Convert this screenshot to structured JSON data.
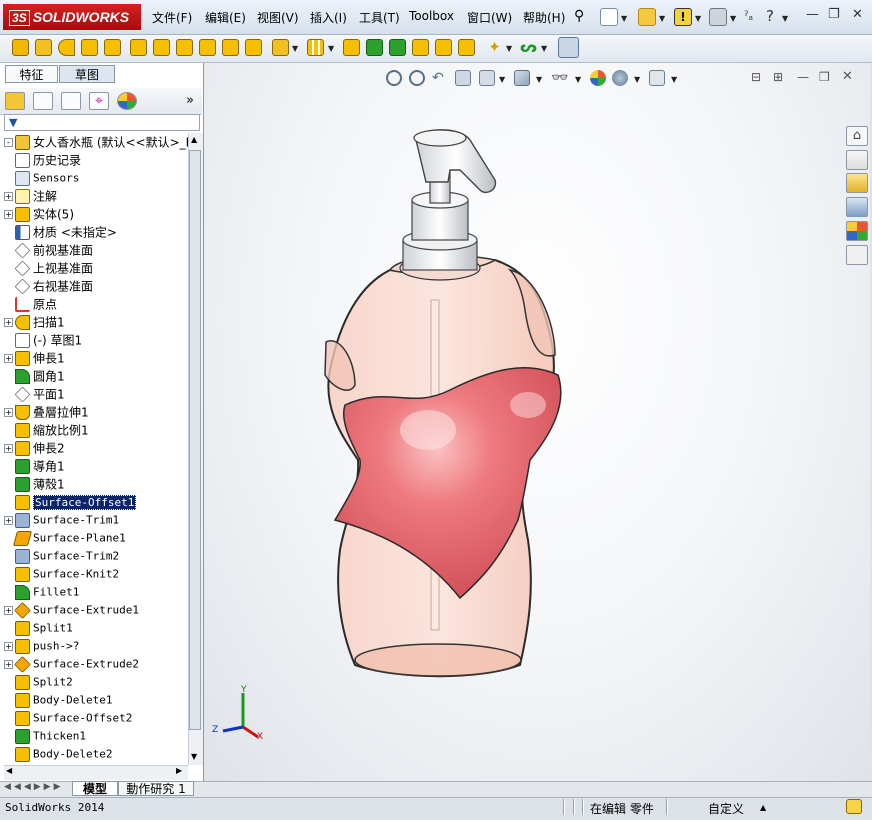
{
  "app": {
    "brand": "SOLIDWORKS",
    "ds_mark": "3S"
  },
  "menu": [
    {
      "label": "文件(F)"
    },
    {
      "label": "编辑(E)"
    },
    {
      "label": "视图(V)"
    },
    {
      "label": "插入(I)"
    },
    {
      "label": "工具(T)"
    },
    {
      "label": "Toolbox"
    },
    {
      "label": "窗口(W)"
    },
    {
      "label": "帮助(H)"
    }
  ],
  "panel_tabs": [
    {
      "label": "特征"
    },
    {
      "label": "草图"
    }
  ],
  "feature_tree": [
    {
      "label": "女人香水瓶  (默认<<默认>_Ph",
      "expand": "-",
      "icon": "part-icon"
    },
    {
      "label": "历史记录",
      "expand": "",
      "icon": "history-icon"
    },
    {
      "label": "Sensors",
      "expand": "",
      "icon": "sensor-icon",
      "mono": true
    },
    {
      "label": "注解",
      "expand": "+",
      "icon": "annotation-icon"
    },
    {
      "label": "实体(5)",
      "expand": "+",
      "icon": "solid-body-icon"
    },
    {
      "label": "材质 <未指定>",
      "expand": "",
      "icon": "material-icon"
    },
    {
      "label": "前视基准面",
      "expand": "",
      "icon": "plane-icon"
    },
    {
      "label": "上视基准面",
      "expand": "",
      "icon": "plane-icon"
    },
    {
      "label": "右视基准面",
      "expand": "",
      "icon": "plane-icon"
    },
    {
      "label": "原点",
      "expand": "",
      "icon": "origin-icon"
    },
    {
      "label": "扫描1",
      "expand": "+",
      "icon": "sweep-icon"
    },
    {
      "label": "(-) 草图1",
      "expand": "",
      "icon": "sketch-icon"
    },
    {
      "label": "伸長1",
      "expand": "+",
      "icon": "extrude-icon"
    },
    {
      "label": "圆角1",
      "expand": "",
      "icon": "fillet-icon"
    },
    {
      "label": "平面1",
      "expand": "",
      "icon": "plane-icon"
    },
    {
      "label": "叠層拉伸1",
      "expand": "+",
      "icon": "loft-icon"
    },
    {
      "label": "縮放比例1",
      "expand": "",
      "icon": "scale-icon"
    },
    {
      "label": "伸長2",
      "expand": "+",
      "icon": "extrude-icon"
    },
    {
      "label": "導角1",
      "expand": "",
      "icon": "chamfer-icon"
    },
    {
      "label": "薄殼1",
      "expand": "",
      "icon": "shell-icon"
    },
    {
      "label": "Surface-Offset1",
      "expand": "",
      "icon": "surface-offset-icon",
      "mono": true,
      "selected": true
    },
    {
      "label": "Surface-Trim1",
      "expand": "+",
      "icon": "surface-trim-icon",
      "mono": true
    },
    {
      "label": "Surface-Plane1",
      "expand": "",
      "icon": "surface-plane-icon",
      "mono": true
    },
    {
      "label": "Surface-Trim2",
      "expand": "",
      "icon": "surface-trim-icon",
      "mono": true
    },
    {
      "label": "Surface-Knit2",
      "expand": "",
      "icon": "surface-knit-icon",
      "mono": true
    },
    {
      "label": "Fillet1",
      "expand": "",
      "icon": "fillet-icon",
      "mono": true
    },
    {
      "label": "Surface-Extrude1",
      "expand": "+",
      "icon": "surface-extrude-icon",
      "mono": true
    },
    {
      "label": "Split1",
      "expand": "",
      "icon": "split-icon",
      "mono": true
    },
    {
      "label": "push->?",
      "expand": "+",
      "icon": "move-body-icon",
      "mono": true
    },
    {
      "label": "Surface-Extrude2",
      "expand": "+",
      "icon": "surface-extrude-icon",
      "mono": true
    },
    {
      "label": "Split2",
      "expand": "",
      "icon": "split-icon",
      "mono": true
    },
    {
      "label": "Body-Delete1",
      "expand": "",
      "icon": "body-delete-icon",
      "mono": true
    },
    {
      "label": "Surface-Offset2",
      "expand": "",
      "icon": "surface-offset-icon",
      "mono": true
    },
    {
      "label": "Thicken1",
      "expand": "",
      "icon": "thicken-icon",
      "mono": true
    },
    {
      "label": "Body-Delete2",
      "expand": "",
      "icon": "body-delete-icon",
      "mono": true
    }
  ],
  "triad": {
    "x": "X",
    "y": "Y",
    "z": "Z"
  },
  "bottom_tabs": [
    {
      "label": "模型"
    },
    {
      "label": "動作研究 1"
    }
  ],
  "status": {
    "version": "SolidWorks 2014",
    "mode": "在编辑 零件",
    "units": "自定义",
    "units_caret": "▲"
  },
  "colors": {
    "brand_red": "#c81414",
    "selection": "#0a246a",
    "bottle_pink": "#e86a70",
    "bottle_glass": "#f6c4b6"
  }
}
